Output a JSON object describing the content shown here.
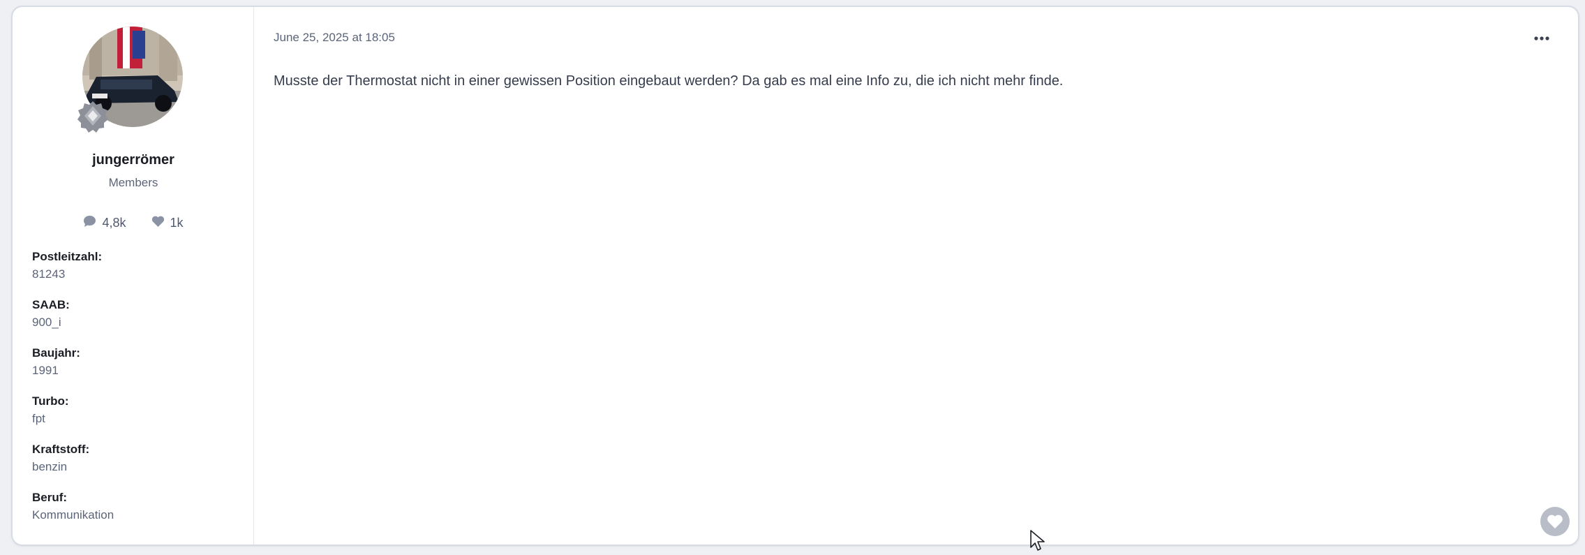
{
  "post": {
    "date": "June 25, 2025 at 18:05",
    "content": "Musste der Thermostat nicht in einer gewissen Position eingebaut werden? Da gab es mal eine Info zu, die ich nicht mehr finde."
  },
  "author": {
    "name": "jungerrömer",
    "group": "Members",
    "stats": {
      "posts": "4,8k",
      "reputation": "1k"
    },
    "fields": [
      {
        "label": "Postleitzahl:",
        "value": "81243"
      },
      {
        "label": "SAAB:",
        "value": "900_i"
      },
      {
        "label": "Baujahr:",
        "value": "1991"
      },
      {
        "label": "Turbo:",
        "value": "fpt"
      },
      {
        "label": "Kraftstoff:",
        "value": "benzin"
      },
      {
        "label": "Beruf:",
        "value": "Kommunikation"
      }
    ]
  },
  "icons": {
    "posts": "speech-bubble-icon",
    "reputation": "heart-icon",
    "more": "ellipsis-icon",
    "like": "heart-icon",
    "rank": "rank-badge-icon"
  },
  "colors": {
    "text_primary": "#1a1d24",
    "text_muted": "#5b6478",
    "icon_gray": "#8a92a3",
    "like_button": "#b8bdc8"
  }
}
